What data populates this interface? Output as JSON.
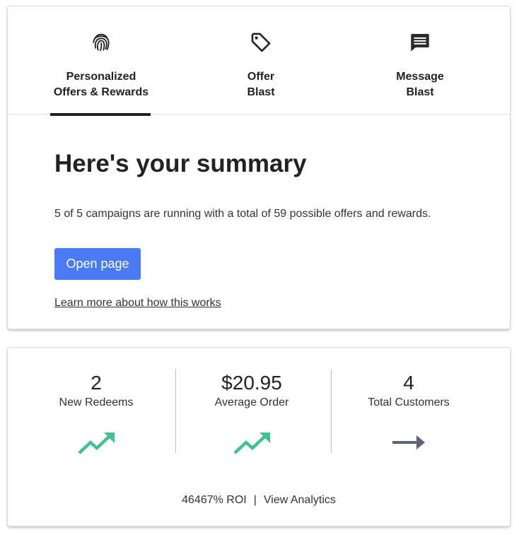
{
  "tabs": [
    {
      "line1": "Personalized",
      "line2": "Offers & Rewards",
      "icon": "fingerprint-icon",
      "active": true
    },
    {
      "line1": "Offer",
      "line2": "Blast",
      "icon": "tag-icon",
      "active": false
    },
    {
      "line1": "Message",
      "line2": "Blast",
      "icon": "message-icon",
      "active": false
    }
  ],
  "summary": {
    "title": "Here's your summary",
    "text": "5 of 5 campaigns are running with a total of 59 possible offers and rewards.",
    "open_button": "Open page",
    "learn_link": "Learn more about how this works"
  },
  "stats": [
    {
      "value": "2",
      "label": "New Redeems",
      "trend": "up",
      "trend_icon": "trending-up-icon"
    },
    {
      "value": "$20.95",
      "label": "Average Order",
      "trend": "up",
      "trend_icon": "trending-up-icon"
    },
    {
      "value": "4",
      "label": "Total Customers",
      "trend": "flat",
      "trend_icon": "arrow-right-icon"
    }
  ],
  "footer": {
    "roi": "46467% ROI",
    "separator": "|",
    "analytics_link": "View Analytics"
  },
  "colors": {
    "primary_button": "#4a7bf7",
    "trend_up": "#3ec28f",
    "trend_flat": "#5b6478",
    "active_tab_underline": "#222222"
  }
}
